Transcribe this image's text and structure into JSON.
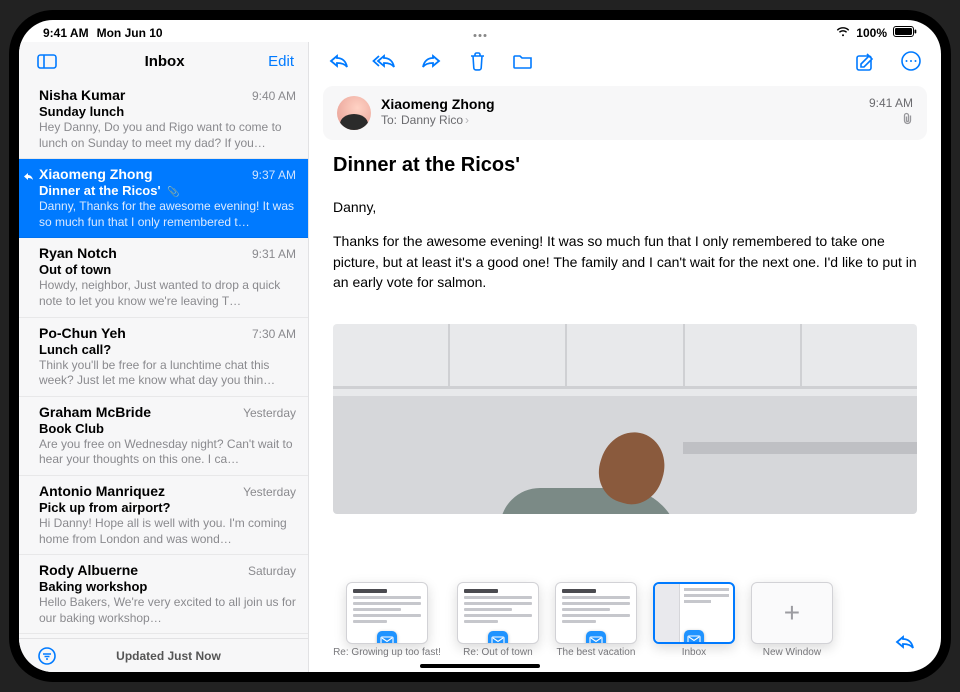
{
  "status": {
    "time": "9:41 AM",
    "date": "Mon Jun 10",
    "wifi_icon": "wifi",
    "battery_text": "100%"
  },
  "sidebar": {
    "title": "Inbox",
    "edit_label": "Edit",
    "updated_label": "Updated Just Now",
    "messages": [
      {
        "sender": "Nisha Kumar",
        "time": "9:40 AM",
        "subject": "Sunday lunch",
        "preview": "Hey Danny, Do you and Rigo want to come to lunch on Sunday to meet my dad? If you…",
        "selected": false,
        "replied": false,
        "has_attachment": false
      },
      {
        "sender": "Xiaomeng Zhong",
        "time": "9:37 AM",
        "subject": "Dinner at the Ricos'",
        "preview": "Danny, Thanks for the awesome evening! It was so much fun that I only remembered t…",
        "selected": true,
        "replied": true,
        "has_attachment": true
      },
      {
        "sender": "Ryan Notch",
        "time": "9:31 AM",
        "subject": "Out of town",
        "preview": "Howdy, neighbor, Just wanted to drop a quick note to let you know we're leaving T…",
        "selected": false,
        "replied": false,
        "has_attachment": false
      },
      {
        "sender": "Po-Chun Yeh",
        "time": "7:30 AM",
        "subject": "Lunch call?",
        "preview": "Think you'll be free for a lunchtime chat this week? Just let me know what day you thin…",
        "selected": false,
        "replied": false,
        "has_attachment": false
      },
      {
        "sender": "Graham McBride",
        "time": "Yesterday",
        "subject": "Book Club",
        "preview": "Are you free on Wednesday night? Can't wait to hear your thoughts on this one. I ca…",
        "selected": false,
        "replied": false,
        "has_attachment": false
      },
      {
        "sender": "Antonio Manriquez",
        "time": "Yesterday",
        "subject": "Pick up from airport?",
        "preview": "Hi Danny! Hope all is well with you. I'm coming home from London and was wond…",
        "selected": false,
        "replied": false,
        "has_attachment": false
      },
      {
        "sender": "Rody Albuerne",
        "time": "Saturday",
        "subject": "Baking workshop",
        "preview": "Hello Bakers, We're very excited to all join us for our baking workshop…",
        "selected": false,
        "replied": false,
        "has_attachment": false
      }
    ]
  },
  "mail": {
    "from": "Xiaomeng Zhong",
    "to_label": "To:",
    "to_name": "Danny Rico",
    "time": "9:41 AM",
    "subject": "Dinner at the Ricos'",
    "greeting": "Danny,",
    "body": "Thanks for the awesome evening! It was so much fun that I only remembered to take one picture, but at least it's a good one! The family and I can't wait for the next one. I'd like to put in an early vote for salmon.",
    "has_attachment": true
  },
  "expose": {
    "windows": [
      {
        "label": "Re: Growing up too fast!",
        "type": "compose"
      },
      {
        "label": "Re: Out of town",
        "type": "compose"
      },
      {
        "label": "The best vacation",
        "type": "compose"
      },
      {
        "label": "Inbox",
        "type": "split",
        "current": true
      }
    ],
    "new_window_label": "New Window"
  }
}
